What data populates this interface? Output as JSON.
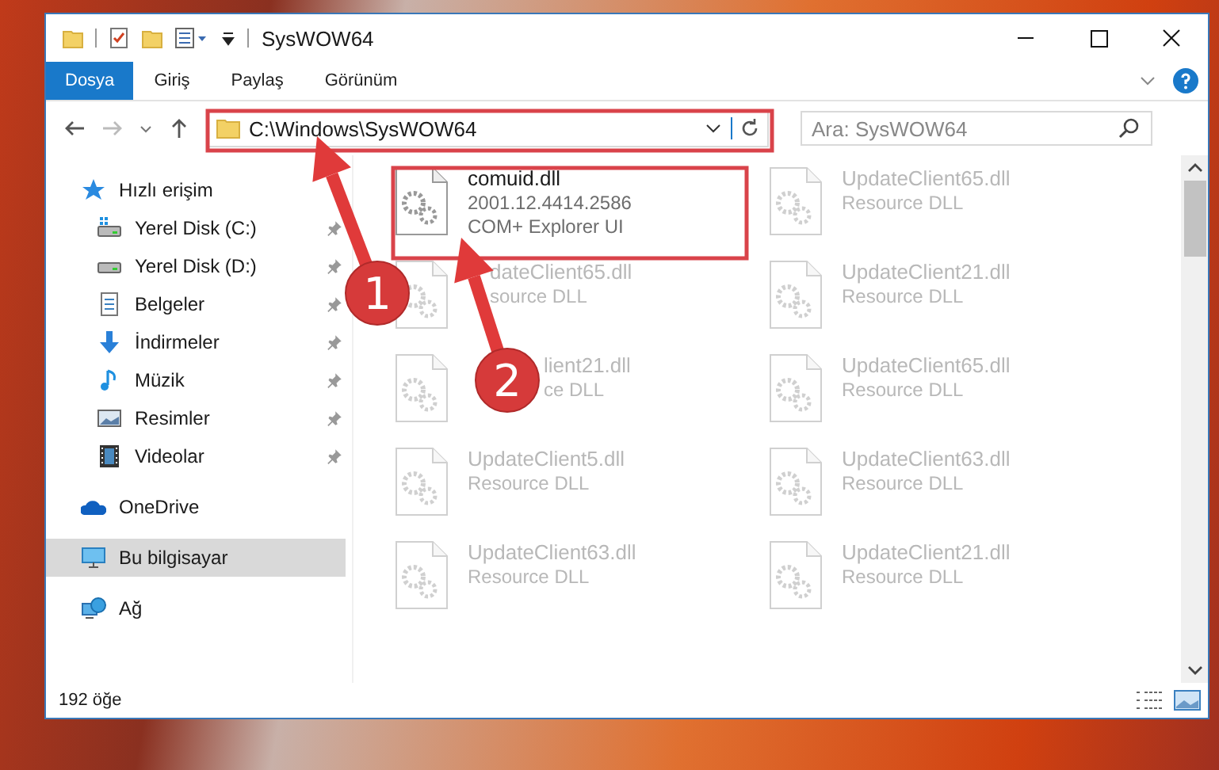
{
  "window": {
    "title": "SysWOW64"
  },
  "ribbon": {
    "tabs": [
      {
        "label": "Dosya",
        "selected": true
      },
      {
        "label": "Giriş",
        "selected": false
      },
      {
        "label": "Paylaş",
        "selected": false
      },
      {
        "label": "Görünüm",
        "selected": false
      }
    ]
  },
  "address_bar": {
    "path": "C:\\Windows\\SysWOW64",
    "search": {
      "placeholder": "Ara: SysWOW64"
    }
  },
  "sidebar": {
    "items": [
      {
        "label": "Hızlı erişim",
        "selected": false,
        "children": [
          {
            "label": "Yerel Disk (C:)",
            "pinned": true,
            "selected": false
          },
          {
            "label": "Yerel Disk (D:)",
            "pinned": true,
            "selected": false
          },
          {
            "label": "Belgeler",
            "pinned": true,
            "selected": false
          },
          {
            "label": "İndirmeler",
            "pinned": true,
            "selected": false
          },
          {
            "label": "Müzik",
            "pinned": true,
            "selected": false
          },
          {
            "label": "Resimler",
            "pinned": true,
            "selected": false
          },
          {
            "label": "Videolar",
            "pinned": true,
            "selected": false
          }
        ]
      },
      {
        "label": "OneDrive",
        "selected": false
      },
      {
        "label": "Bu bilgisayar",
        "selected": true
      },
      {
        "label": "Ağ",
        "selected": false
      }
    ]
  },
  "files": [
    {
      "name": "comuid.dll",
      "details": [
        "2001.12.4414.2586",
        "COM+ Explorer UI"
      ],
      "blurred": false
    },
    {
      "name": "UpdateClient65.dll",
      "details": [
        "Resource DLL"
      ],
      "blurred": true
    },
    {
      "name": "dateClient65.dll",
      "details": [
        "source DLL"
      ],
      "blurred": true,
      "covered": true
    },
    {
      "name": "UpdateClient21.dll",
      "details": [
        "Resource DLL"
      ],
      "blurred": true
    },
    {
      "name": "lient21.dll",
      "details": [
        "ce DLL"
      ],
      "blurred": true,
      "covered": true
    },
    {
      "name": "UpdateClient65.dll",
      "details": [
        "Resource DLL"
      ],
      "blurred": true
    },
    {
      "name": "UpdateClient5.dll",
      "details": [
        "Resource DLL"
      ],
      "blurred": true
    },
    {
      "name": "UpdateClient63.dll",
      "details": [
        "Resource DLL"
      ],
      "blurred": true
    },
    {
      "name": "UpdateClient63.dll",
      "details": [
        "Resource DLL"
      ],
      "blurred": true
    },
    {
      "name": "UpdateClient21.dll",
      "details": [
        "Resource DLL"
      ],
      "blurred": true
    }
  ],
  "status_bar": {
    "count": "192 öğe"
  },
  "annotations": [
    {
      "number": "1"
    },
    {
      "number": "2"
    }
  ]
}
